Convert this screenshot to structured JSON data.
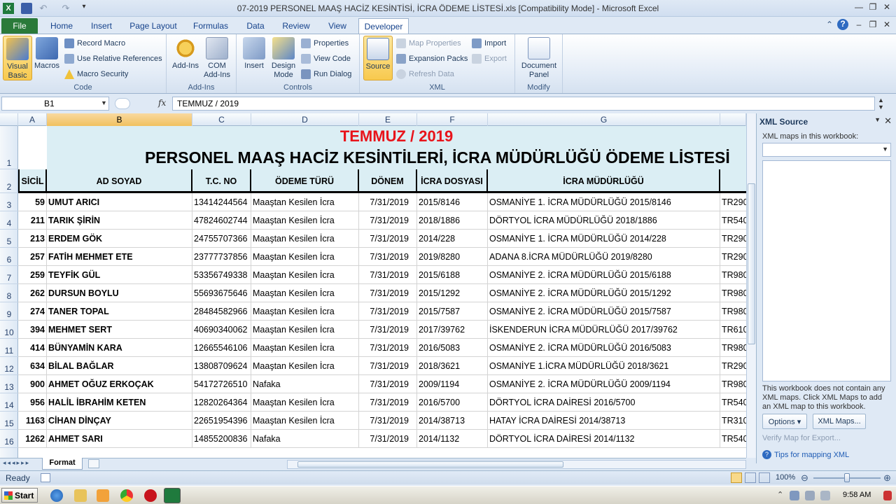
{
  "app": {
    "title": "07-2019 PERSONEL MAAŞ HACİZ KESİNTİSİ, İCRA ÖDEME LİSTESİ.xls  [Compatibility Mode]  -  Microsoft Excel",
    "excel_icon_letter": "X"
  },
  "tabs": [
    "File",
    "Home",
    "Insert",
    "Page Layout",
    "Formulas",
    "Data",
    "Review",
    "View",
    "Developer"
  ],
  "ribbon": {
    "code": {
      "label": "Code",
      "visual_basic": "Visual Basic",
      "macros": "Macros",
      "record_macro": "Record Macro",
      "relative_refs": "Use Relative References",
      "macro_security": "Macro Security"
    },
    "addins": {
      "label": "Add-Ins",
      "addins": "Add-Ins",
      "com_addins": "COM Add-Ins"
    },
    "controls": {
      "label": "Controls",
      "insert": "Insert",
      "design_mode": "Design Mode",
      "properties": "Properties",
      "view_code": "View Code",
      "run_dialog": "Run Dialog"
    },
    "xml": {
      "label": "XML",
      "source": "Source",
      "map_properties": "Map Properties",
      "expansion_packs": "Expansion Packs",
      "refresh_data": "Refresh Data",
      "import": "Import",
      "export": "Export"
    },
    "modify": {
      "label": "Modify",
      "document_panel": "Document Panel"
    }
  },
  "formula_bar": {
    "name_box": "B1",
    "fx": "fx",
    "value": "TEMMUZ / 2019"
  },
  "columns": [
    "A",
    "B",
    "C",
    "D",
    "E",
    "F",
    "G"
  ],
  "sheet": {
    "title1": "TEMMUZ / 2019",
    "title2": "PERSONEL MAAŞ HACİZ KESİNTİLERİ, İCRA MÜDÜRLÜĞÜ ÖDEME LİSTESİ",
    "headers": [
      "SİCİL",
      "AD SOYAD",
      "T.C. NO",
      "ÖDEME TÜRÜ",
      "DÖNEM",
      "İCRA DOSYASI",
      "İCRA MÜDÜRLÜĞÜ"
    ],
    "row_numbers": [
      "1",
      "2",
      "3",
      "4",
      "5",
      "6",
      "7",
      "8",
      "9",
      "10",
      "11",
      "12",
      "13",
      "14",
      "15",
      "16"
    ],
    "rows": [
      [
        "59",
        "UMUT ARICI",
        "13414244564",
        "Maaştan Kesilen İcra",
        "7/31/2019",
        "2015/8146",
        "OSMANİYE 1. İCRA MÜDÜRLÜĞÜ 2015/8146",
        "TR290"
      ],
      [
        "211",
        "TARIK ŞİRİN",
        "47824602744",
        "Maaştan Kesilen İcra",
        "7/31/2019",
        "2018/1886",
        "DÖRTYOL İCRA MÜDÜRLÜĞÜ 2018/1886",
        "TR540"
      ],
      [
        "213",
        "ERDEM GÖK",
        "24755707366",
        "Maaştan Kesilen İcra",
        "7/31/2019",
        "2014/228",
        "OSMANİYE 1. İCRA MÜDÜRLÜĞÜ 2014/228",
        "TR290"
      ],
      [
        "257",
        "FATİH MEHMET ETE",
        "23777737856",
        "Maaştan Kesilen İcra",
        "7/31/2019",
        "2019/8280",
        "ADANA 8.İCRA MÜDÜRLÜĞÜ 2019/8280",
        "TR290"
      ],
      [
        "259",
        "TEYFİK GÜL",
        "53356749338",
        "Maaştan Kesilen İcra",
        "7/31/2019",
        "2015/6188",
        "OSMANİYE 2. İCRA MÜDÜRLÜĞÜ 2015/6188",
        "TR980"
      ],
      [
        "262",
        "DURSUN BOYLU",
        "55693675646",
        "Maaştan Kesilen İcra",
        "7/31/2019",
        "2015/1292",
        "OSMANİYE 2. İCRA MÜDÜRLÜĞÜ 2015/1292",
        "TR980"
      ],
      [
        "274",
        "TANER TOPAL",
        "28484582966",
        "Maaştan Kesilen İcra",
        "7/31/2019",
        "2015/7587",
        "OSMANİYE 2. İCRA MÜDÜRLÜĞÜ 2015/7587",
        "TR980"
      ],
      [
        "394",
        "MEHMET SERT",
        "40690340062",
        "Maaştan Kesilen İcra",
        "7/31/2019",
        "2017/39762",
        "İSKENDERUN İCRA MÜDÜRLÜĞÜ 2017/39762",
        "TR610"
      ],
      [
        "414",
        "BÜNYAMİN KARA",
        "12665546106",
        "Maaştan Kesilen İcra",
        "7/31/2019",
        "2016/5083",
        "OSMANİYE 2. İCRA MÜDÜRLÜĞÜ 2016/5083",
        "TR980"
      ],
      [
        "634",
        "BİLAL BAĞLAR",
        "13808709624",
        "Maaştan Kesilen İcra",
        "7/31/2019",
        "2018/3621",
        "OSMANİYE 1.İCRA MÜDÜRLÜĞÜ 2018/3621",
        "TR290"
      ],
      [
        "900",
        "AHMET OĞUZ ERKOÇAK",
        "54172726510",
        "Nafaka",
        "7/31/2019",
        "2009/1194",
        "OSMANİYE 2. İCRA MÜDÜRLÜĞÜ 2009/1194",
        "TR980"
      ],
      [
        "956",
        "HALİL İBRAHİM KETEN",
        "12820264364",
        "Maaştan Kesilen İcra",
        "7/31/2019",
        "2016/5700",
        "DÖRTYOL İCRA DAİRESİ 2016/5700",
        "TR540"
      ],
      [
        "1163",
        "CİHAN DİNÇAY",
        "22651954396",
        "Maaştan Kesilen İcra",
        "7/31/2019",
        "2014/38713",
        "HATAY İCRA DAİRESİ 2014/38713",
        "TR310"
      ],
      [
        "1262",
        "AHMET SARI",
        "14855200836",
        "Nafaka",
        "7/31/2019",
        "2014/1132",
        "DÖRTYOL İCRA DAİRESİ 2014/1132",
        "TR540"
      ]
    ]
  },
  "xml_pane": {
    "title": "XML Source",
    "maps_label": "XML maps in this workbook:",
    "message": "This workbook does not contain any XML maps. Click XML Maps to add an XML map to this workbook.",
    "options": "Options",
    "xml_maps": "XML Maps...",
    "verify": "Verify Map for Export...",
    "tips": "Tips for mapping XML"
  },
  "sheet_tabs": [
    "Format"
  ],
  "status": {
    "ready": "Ready",
    "zoom": "100%"
  },
  "taskbar": {
    "start": "Start",
    "clock": "9:58 AM"
  }
}
